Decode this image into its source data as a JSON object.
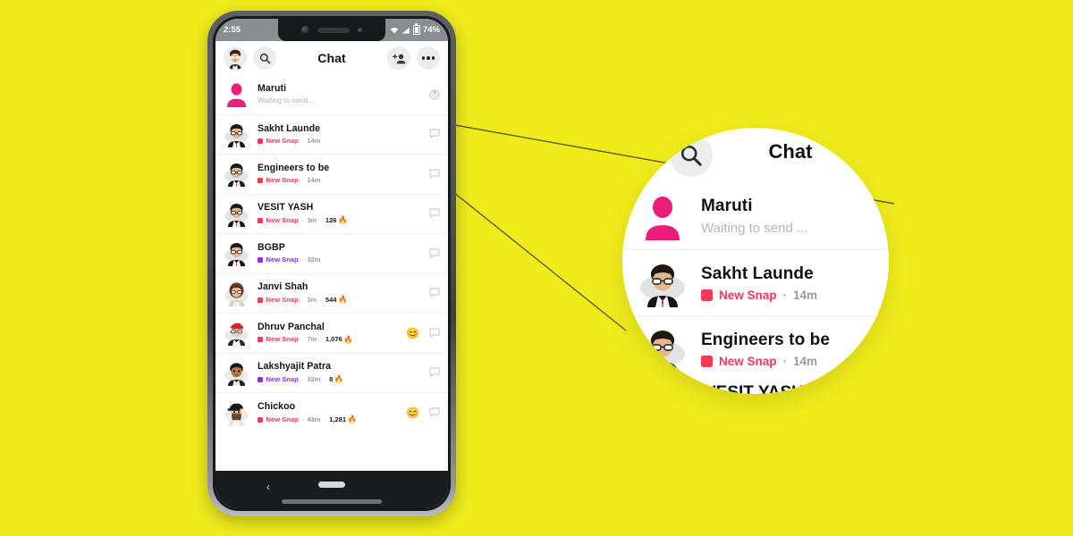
{
  "background_color": "#F0EC1C",
  "device": {
    "status_bar": {
      "time": "2:55",
      "battery_percent": "74%",
      "icons": [
        "wifi-icon",
        "signal-icon",
        "battery-icon"
      ]
    },
    "nav_bar": {
      "back_label": "‹",
      "home_indicator": "home-pill"
    }
  },
  "app": {
    "header": {
      "title": "Chat",
      "profile_icon": "bitmoji-avatar-icon",
      "search_icon": "search-icon",
      "add_friend_icon": "add-friend-icon",
      "more_icon": "more-options-icon"
    },
    "colors": {
      "new_snap_red": "#F23B57",
      "new_snap_purple": "#9333D6",
      "maruti_pink": "#ED1E79",
      "muted_text": "#9B9B9B",
      "icon_gray": "#BFBFBF"
    },
    "chats": [
      {
        "name": "Maruti",
        "status": "",
        "status_color": "",
        "subtitle": "Waiting to send ...",
        "time": "",
        "streak": "",
        "avatar": "pink-ghost-avatar",
        "emoji": "",
        "action_icon": "camera-icon"
      },
      {
        "name": "Sakht Launde",
        "status": "New Snap",
        "status_color": "#F23B57",
        "subtitle": "",
        "time": "14m",
        "streak": "",
        "avatar": "bitmoji-suit-glasses",
        "emoji": "",
        "action_icon": "chat-bubble-icon"
      },
      {
        "name": "Engineers to be",
        "status": "New Snap",
        "status_color": "#F23B57",
        "subtitle": "",
        "time": "14m",
        "streak": "",
        "avatar": "bitmoji-suit-glasses",
        "emoji": "",
        "action_icon": "chat-bubble-icon"
      },
      {
        "name": "VESIT YASH",
        "status": "New Snap",
        "status_color": "#F23B57",
        "subtitle": "",
        "time": "3m",
        "streak": "126",
        "avatar": "bitmoji-suit-glasses",
        "emoji": "",
        "action_icon": "chat-bubble-icon"
      },
      {
        "name": "BGBP",
        "status": "New Snap",
        "status_color": "#9333D6",
        "subtitle": "",
        "time": "32m",
        "streak": "",
        "avatar": "bitmoji-suit-glasses",
        "emoji": "",
        "action_icon": "chat-bubble-icon"
      },
      {
        "name": "Janvi Shah",
        "status": "New Snap",
        "status_color": "#F23B57",
        "subtitle": "",
        "time": "3m",
        "streak": "544",
        "avatar": "bitmoji-girl-brown-hair",
        "emoji": "",
        "action_icon": "chat-bubble-icon"
      },
      {
        "name": "Dhruv Panchal",
        "status": "New Snap",
        "status_color": "#F23B57",
        "subtitle": "",
        "time": "7m",
        "streak": "1,076",
        "avatar": "bitmoji-santa-hat",
        "emoji": "😊",
        "action_icon": "chat-bubble-icon"
      },
      {
        "name": "Lakshyajit Patra",
        "status": "New Snap",
        "status_color": "#9333D6",
        "subtitle": "",
        "time": "32m",
        "streak": "8",
        "avatar": "bitmoji-dark-hair",
        "emoji": "",
        "action_icon": "chat-bubble-icon"
      },
      {
        "name": "Chickoo",
        "status": "New Snap",
        "status_color": "#F23B57",
        "subtitle": "",
        "time": "43m",
        "streak": "1,281",
        "avatar": "bitmoji-girl-black-cap",
        "emoji": "😊",
        "action_icon": "chat-bubble-icon"
      }
    ],
    "streak_emoji": "🔥",
    "separator": "·"
  },
  "magnifier": {
    "title": "Chat",
    "search_icon": "search-icon",
    "rows": [
      {
        "name": "Maruti",
        "status": "",
        "status_color": "",
        "subtitle": "Waiting to send ...",
        "time": "",
        "avatar": "pink-ghost-avatar"
      },
      {
        "name": "Sakht Launde",
        "status": "New Snap",
        "status_color": "#F23B57",
        "subtitle": "",
        "time": "14m",
        "avatar": "bitmoji-suit-glasses"
      },
      {
        "name": "Engineers to be",
        "status": "New Snap",
        "status_color": "#F23B57",
        "subtitle": "",
        "time": "14m",
        "avatar": "bitmoji-suit-glasses"
      }
    ],
    "clipped_row_name": "VESIT YASH",
    "separator": "·"
  }
}
